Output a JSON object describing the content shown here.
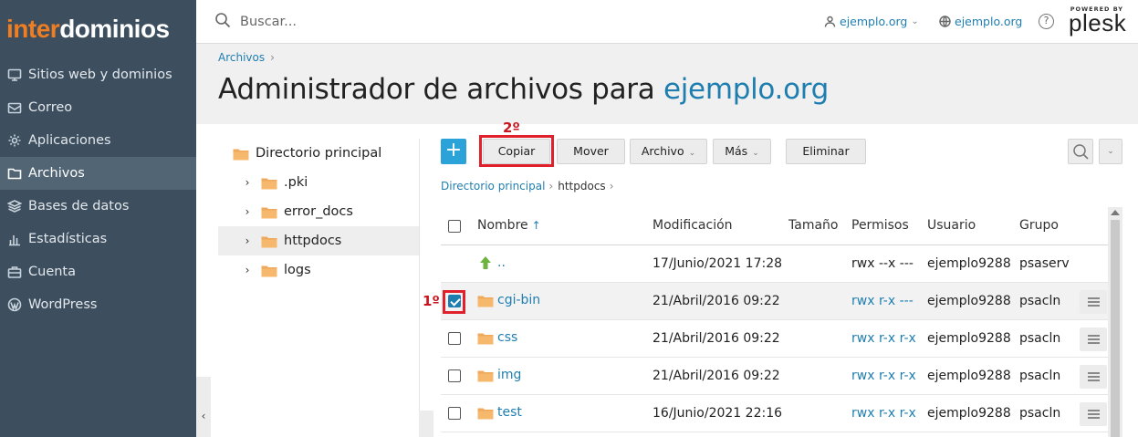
{
  "sidebar": {
    "logo_part1": "inter",
    "logo_part2": "dominios",
    "items": [
      {
        "label": "Sitios web y dominios",
        "icon": "monitor-icon"
      },
      {
        "label": "Correo",
        "icon": "envelope-icon"
      },
      {
        "label": "Aplicaciones",
        "icon": "gear-icon"
      },
      {
        "label": "Archivos",
        "icon": "folder-icon",
        "active": true
      },
      {
        "label": "Bases de datos",
        "icon": "layers-icon"
      },
      {
        "label": "Estadísticas",
        "icon": "bar-chart-icon"
      },
      {
        "label": "Cuenta",
        "icon": "briefcase-icon"
      },
      {
        "label": "WordPress",
        "icon": "wordpress-icon"
      }
    ]
  },
  "topbar": {
    "search_placeholder": "Buscar...",
    "account_link": "ejemplo.org",
    "domain_link": "ejemplo.org",
    "help": "?",
    "powered_by": "POWERED BY",
    "plesk": "plesk"
  },
  "header": {
    "breadcrumb": "Archivos",
    "title_prefix": "Administrador de archivos para ",
    "title_domain": "ejemplo.org"
  },
  "tree": {
    "root": "Directorio principal",
    "items": [
      ".pki",
      "error_docs",
      "httpdocs",
      "logs"
    ],
    "selected": "httpdocs"
  },
  "toolbar": {
    "add": "+",
    "copy": "Copiar",
    "move": "Mover",
    "file": "Archivo",
    "more": "Más",
    "delete": "Eliminar"
  },
  "annotations": {
    "step1": "1º",
    "step2": "2º"
  },
  "path": {
    "root": "Directorio principal",
    "current": "httpdocs"
  },
  "table": {
    "columns": {
      "name": "Nombre",
      "modified": "Modificación",
      "size": "Tamaño",
      "permissions": "Permisos",
      "user": "Usuario",
      "group": "Grupo"
    },
    "rows": [
      {
        "name": "..",
        "modified": "17/Junio/2021 17:28",
        "permissions": "rwx --x ---",
        "user": "ejemplo9288",
        "group": "psaserv"
      },
      {
        "name": "cgi-bin",
        "modified": "21/Abril/2016 09:22",
        "permissions": "rwx r-x ---",
        "user": "ejemplo9288",
        "group": "psacln",
        "checked": true
      },
      {
        "name": "css",
        "modified": "21/Abril/2016 09:22",
        "permissions": "rwx r-x r-x",
        "user": "ejemplo9288",
        "group": "psacln"
      },
      {
        "name": "img",
        "modified": "21/Abril/2016 09:22",
        "permissions": "rwx r-x r-x",
        "user": "ejemplo9288",
        "group": "psacln"
      },
      {
        "name": "test",
        "modified": "16/Junio/2021 22:16",
        "permissions": "rwx r-x r-x",
        "user": "ejemplo9288",
        "group": "psacln"
      }
    ]
  },
  "colors": {
    "sidebar_bg": "#3d4f5f",
    "accent": "#1f7eb0",
    "logo_orange": "#ef7d22",
    "highlight_red": "#e0202a"
  }
}
